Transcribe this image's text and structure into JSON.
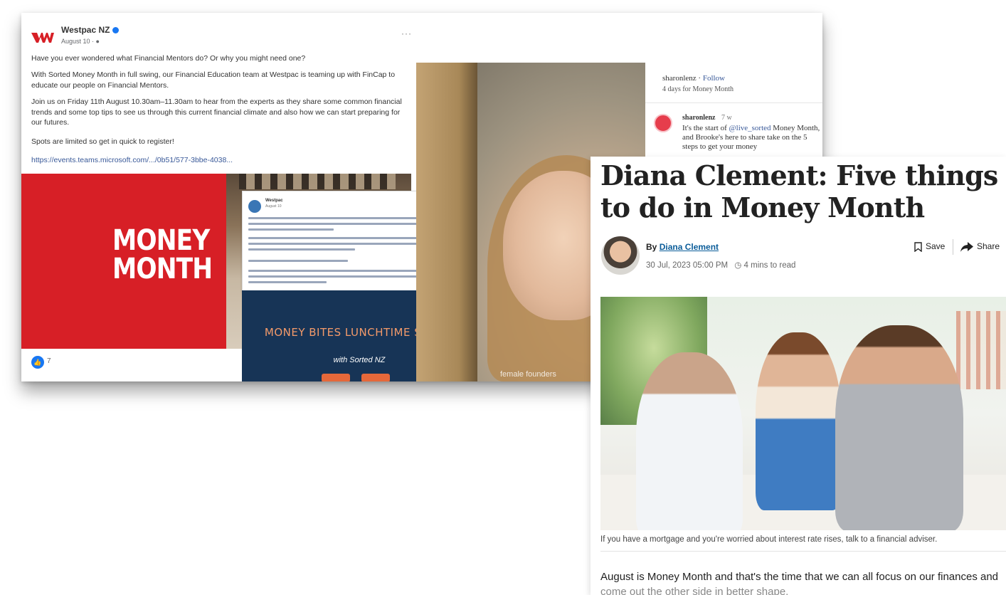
{
  "facebook_post": {
    "page_name": "Westpac NZ",
    "date": "August 10 · ",
    "paragraphs": [
      "Have you ever wondered what Financial Mentors do? Or why you might need one?",
      "With Sorted Money Month in full swing, our Financial Education team at Westpac is teaming up with FinCap to educate our people on Financial Mentors.",
      "Join us on Friday 11th August 10.30am–11.30am to hear from the experts as they share some common financial trends and some top tips to see us through this current financial climate and also how we can start preparing for our futures.",
      "Spots are limited so get in quick to register!"
    ],
    "link": "https://events.teams.microsoft.com/.../0b51/577-3bbe-4038...",
    "graphic_title": "MONEY MONTH",
    "money_bites_title": "MONEY BITES LUNCHTIME SERIES",
    "money_bites_sub": "with Sorted NZ",
    "inner_post_name": "Westpac",
    "inner_post_date": "August 10",
    "like_count": "7"
  },
  "comments": {
    "header_user": "sharonlenz",
    "follow_label": "Follow",
    "subheader": "4 days for Money Month",
    "comment_user": "sharonlenz",
    "comment_time": "7 w",
    "comment_text_start": "It's the start of ",
    "comment_tag": "@live_sorted",
    "comment_text_end": " Money Month, and Brooke's here to share take on the 5 steps to get your money"
  },
  "video": {
    "caption": "female founders"
  },
  "article": {
    "headline": "Diana Clement: Five things to do in Money Month",
    "by_label": "By",
    "author": "Diana Clement",
    "date": "30 Jul, 2023 05:00 PM",
    "read_time": "4 mins to read",
    "save_label": "Save",
    "share_label": "Share",
    "photo_caption": "If you have a mortgage and you're worried about interest rate rises, talk to a financial adviser.",
    "body_line1": "August is Money Month and that's the time that we can all focus on our finances and",
    "body_line2": "come out the other side in better shape."
  },
  "colors": {
    "westpac_red": "#d71f26",
    "link_blue": "#385898",
    "author_link": "#0a5c99",
    "money_bites_navy": "#173456"
  }
}
